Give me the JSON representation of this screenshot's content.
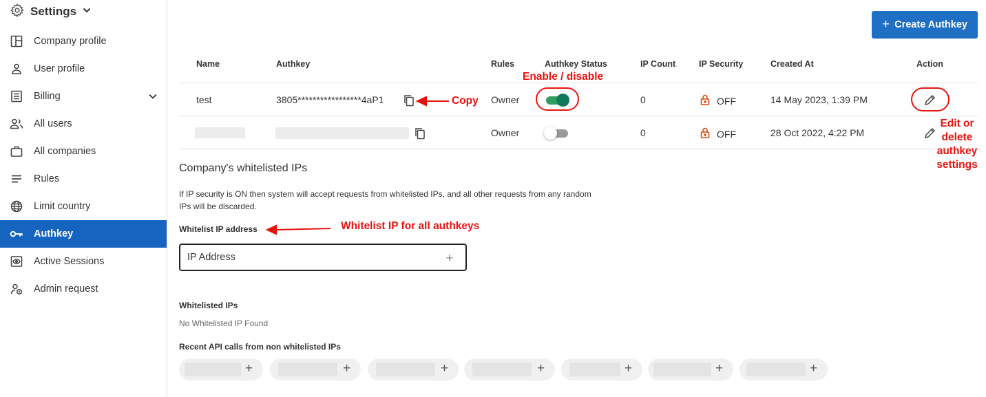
{
  "sidebar": {
    "title": "Settings",
    "items": [
      {
        "label": "Company profile",
        "icon": "layout-icon"
      },
      {
        "label": "User profile",
        "icon": "person-icon"
      },
      {
        "label": "Billing",
        "icon": "receipt-icon",
        "expandable": true
      },
      {
        "label": "All users",
        "icon": "users-icon"
      },
      {
        "label": "All companies",
        "icon": "briefcase-icon"
      },
      {
        "label": "Rules",
        "icon": "lines-icon"
      },
      {
        "label": "Limit country",
        "icon": "globe-icon"
      },
      {
        "label": "Authkey",
        "icon": "key-icon",
        "active": true
      },
      {
        "label": "Active Sessions",
        "icon": "eye-icon"
      },
      {
        "label": "Admin request",
        "icon": "admin-icon"
      }
    ]
  },
  "toolbar": {
    "create_label": "Create Authkey"
  },
  "table": {
    "headers": [
      "Name",
      "Authkey",
      "Rules",
      "Authkey Status",
      "IP Count",
      "IP Security",
      "Created At",
      "Action"
    ],
    "rows": [
      {
        "name": "test",
        "authkey": "3805*****************4aP1",
        "rules": "Owner",
        "status_on": true,
        "ip_count": "0",
        "ip_security": "OFF",
        "created_at": "14 May 2023, 1:39 PM"
      },
      {
        "name": "",
        "authkey": "",
        "rules": "Owner",
        "status_on": false,
        "ip_count": "0",
        "ip_security": "OFF",
        "created_at": "28 Oct 2022, 4:22 PM"
      }
    ]
  },
  "whitelist": {
    "title": "Company's whitelisted IPs",
    "description": "If IP security is ON then system will accept requests from whitelisted IPs, and all other requests from any random IPs will be discarded.",
    "input_label": "Whitelist IP address",
    "input_placeholder": "IP Address",
    "list_label": "Whitelisted IPs",
    "empty_text": "No Whitelisted IP Found",
    "recent_label": "Recent API calls from non whitelisted IPs"
  },
  "annotations": {
    "enable": "Enable / disable",
    "copy": "Copy",
    "whitelist": "Whitelist IP for all authkeys",
    "edit_line1": "Edit or",
    "edit_line2": "delete",
    "edit_line3": "authkey",
    "edit_line4": "settings"
  },
  "colors": {
    "primary": "#1f6fc5",
    "active_nav": "#1565c0",
    "annotation": "#e8120c",
    "toggle_on": "#0f7a5a",
    "lock": "#d9480f"
  }
}
